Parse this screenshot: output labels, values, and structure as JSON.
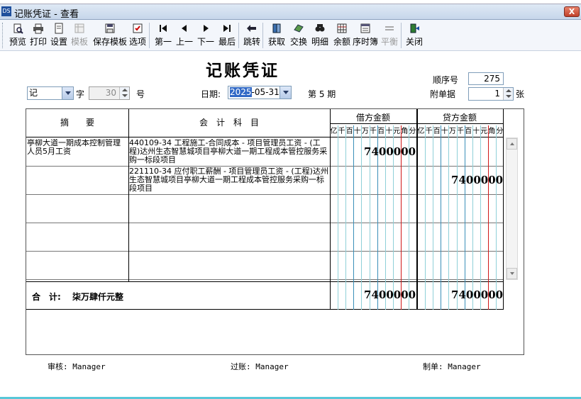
{
  "window": {
    "title": "记账凭证 - 查看",
    "app_icon": "DS",
    "close": "X"
  },
  "toolbar": {
    "items": [
      {
        "label": "预览",
        "icon": "preview-icon",
        "disabled": false
      },
      {
        "label": "打印",
        "icon": "printer-icon",
        "disabled": false
      },
      {
        "label": "设置",
        "icon": "page-setup-icon",
        "disabled": false
      },
      {
        "label": "模板",
        "icon": "template-icon",
        "disabled": true
      },
      {
        "label": "保存模板",
        "icon": "save-template-icon",
        "disabled": false
      },
      {
        "label": "选项",
        "icon": "options-icon",
        "disabled": false
      },
      {
        "label": "第一",
        "icon": "first-icon",
        "disabled": false
      },
      {
        "label": "上一",
        "icon": "prev-icon",
        "disabled": false
      },
      {
        "label": "下一",
        "icon": "next-icon",
        "disabled": false
      },
      {
        "label": "最后",
        "icon": "last-icon",
        "disabled": false
      },
      {
        "label": "跳转",
        "icon": "jump-icon",
        "disabled": false
      },
      {
        "label": "获取",
        "icon": "fetch-icon",
        "disabled": false
      },
      {
        "label": "交换",
        "icon": "exchange-icon",
        "disabled": false
      },
      {
        "label": "明细",
        "icon": "detail-icon",
        "disabled": false
      },
      {
        "label": "余额",
        "icon": "balance-icon",
        "disabled": false
      },
      {
        "label": "序时簿",
        "icon": "journal-icon",
        "disabled": false
      },
      {
        "label": "平衡",
        "icon": "balance-check-icon",
        "disabled": true
      },
      {
        "label": "关闭",
        "icon": "close-door-icon",
        "disabled": false
      }
    ]
  },
  "form": {
    "title": "记账凭证",
    "voucher_word": "记",
    "zi_label": "字",
    "number": "30",
    "hao_label": "号",
    "date_label": "日期:",
    "date_year": "2025",
    "date_rest": "-05-31",
    "period": "第 5 期",
    "seq_label": "顺序号",
    "seq_value": "275",
    "attach_label": "附单据",
    "attach_value": "1",
    "attach_unit": "张"
  },
  "table": {
    "headers": {
      "summary": "摘　　要",
      "account": "会　计　科　目",
      "debit": "借方金额",
      "credit": "贷方金额",
      "units": [
        "亿",
        "千",
        "百",
        "十",
        "万",
        "千",
        "百",
        "十",
        "元",
        "角",
        "分"
      ]
    },
    "rows": [
      {
        "summary": "亭柳大道一期成本控制管理人员5月工资",
        "account": "440109-34 工程施工-合同成本 - 项目管理员工资 - (工程)达州生态智慧城项目亭柳大道一期工程成本管控服务采购一标段项目",
        "debit": "7400000",
        "credit": ""
      },
      {
        "summary": "",
        "account": "221110-34 应付职工薪酬 - 项目管理员工资 - (工程)达州生态智慧城项目亭柳大道一期工程成本管控服务采购一标段项目",
        "debit": "",
        "credit": "7400000"
      }
    ],
    "total_label": "合　计:　 柒万肆仟元整",
    "total_debit": "7400000",
    "total_credit": "7400000"
  },
  "footer": {
    "auditor": "审核: Manager",
    "poster": "过账: Manager",
    "maker": "制单: Manager"
  }
}
